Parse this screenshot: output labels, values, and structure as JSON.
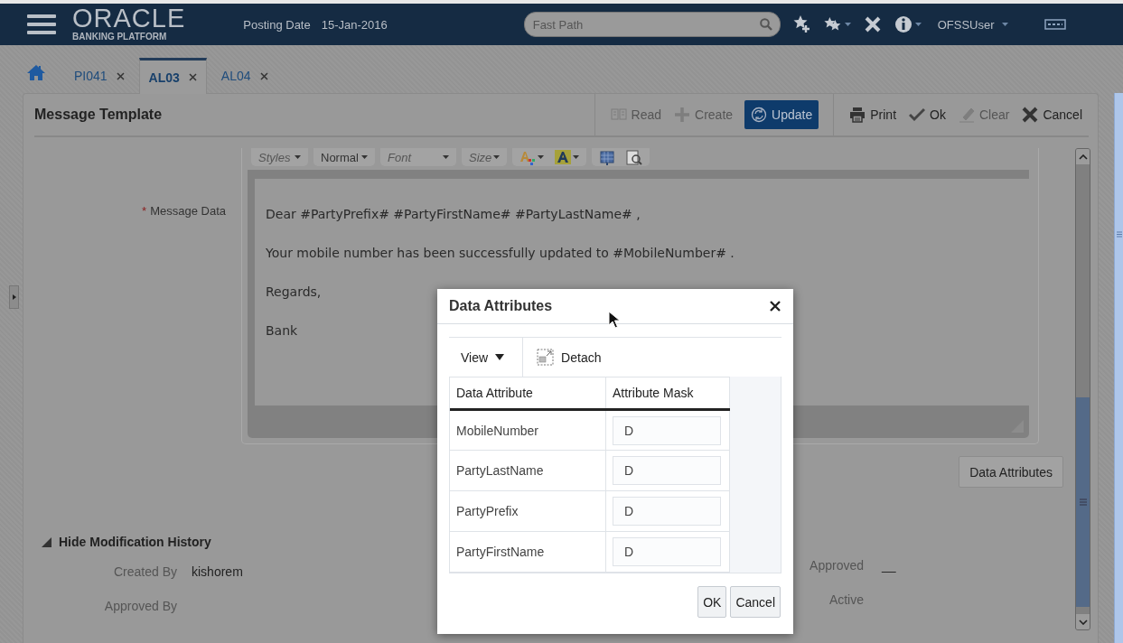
{
  "header": {
    "logo_text": "ORACLE",
    "logo_subtitle": "BANKING PLATFORM",
    "posting_date_label": "Posting Date",
    "posting_date": "15-Jan-2016",
    "fast_path": {
      "placeholder": "Fast Path"
    },
    "user": "OFSSUser"
  },
  "tabs": [
    {
      "label": "PI041",
      "selected": false
    },
    {
      "label": "AL03",
      "selected": true
    },
    {
      "label": "AL04",
      "selected": false
    }
  ],
  "panel": {
    "title": "Message Template",
    "toolbar": [
      {
        "label": "Read",
        "kind": "read",
        "disabled": true,
        "primary": false
      },
      {
        "label": "Create",
        "kind": "create",
        "disabled": true,
        "primary": false
      },
      {
        "label": "Update",
        "kind": "update",
        "disabled": false,
        "primary": true
      },
      {
        "label": "Print",
        "kind": "print",
        "disabled": false,
        "primary": false
      },
      {
        "label": "Ok",
        "kind": "ok",
        "disabled": false,
        "primary": false
      },
      {
        "label": "Clear",
        "kind": "clear",
        "disabled": true,
        "primary": false
      },
      {
        "label": "Cancel",
        "kind": "cancel",
        "disabled": false,
        "primary": false
      }
    ],
    "message_data": {
      "required_mark": "*",
      "label": "Message Data",
      "editor_toolbar": [
        {
          "kind": "dropdown",
          "placeholder": "Styles"
        },
        {
          "kind": "dropdown",
          "value": "Normal"
        },
        {
          "kind": "dropdown",
          "placeholder": "Font"
        },
        {
          "kind": "dropdown",
          "placeholder": "Size"
        },
        {
          "kind": "text-color"
        },
        {
          "kind": "background-color"
        },
        {
          "kind": "source"
        },
        {
          "kind": "preview"
        }
      ],
      "paragraphs": [
        "Dear #PartyPrefix# #PartyFirstName# #PartyLastName# ,",
        "Your mobile number has been successfully updated to #MobileNumber# .",
        "Regards,",
        "Bank"
      ]
    },
    "data_attributes_button": "Data Attributes",
    "history": {
      "toggle": "Hide Modification History",
      "expanded": true,
      "left_fields": [
        {
          "label": "Created By",
          "value": "kishorem"
        },
        {
          "label": "Approved By"
        }
      ],
      "right_fields": [
        {
          "label": "Approved",
          "value": "__"
        },
        {
          "label": "Active"
        }
      ]
    }
  },
  "dialog": {
    "title": "Data Attributes",
    "view_menu": "View",
    "detach": "Detach",
    "columns": [
      "Data Attribute",
      "Attribute Mask"
    ],
    "rows": [
      {
        "attribute": "MobileNumber",
        "mask": "D"
      },
      {
        "attribute": "PartyLastName",
        "mask": "D"
      },
      {
        "attribute": "PartyPrefix",
        "mask": "D"
      },
      {
        "attribute": "PartyFirstName",
        "mask": "D"
      }
    ],
    "buttons": [
      "OK",
      "Cancel"
    ]
  }
}
